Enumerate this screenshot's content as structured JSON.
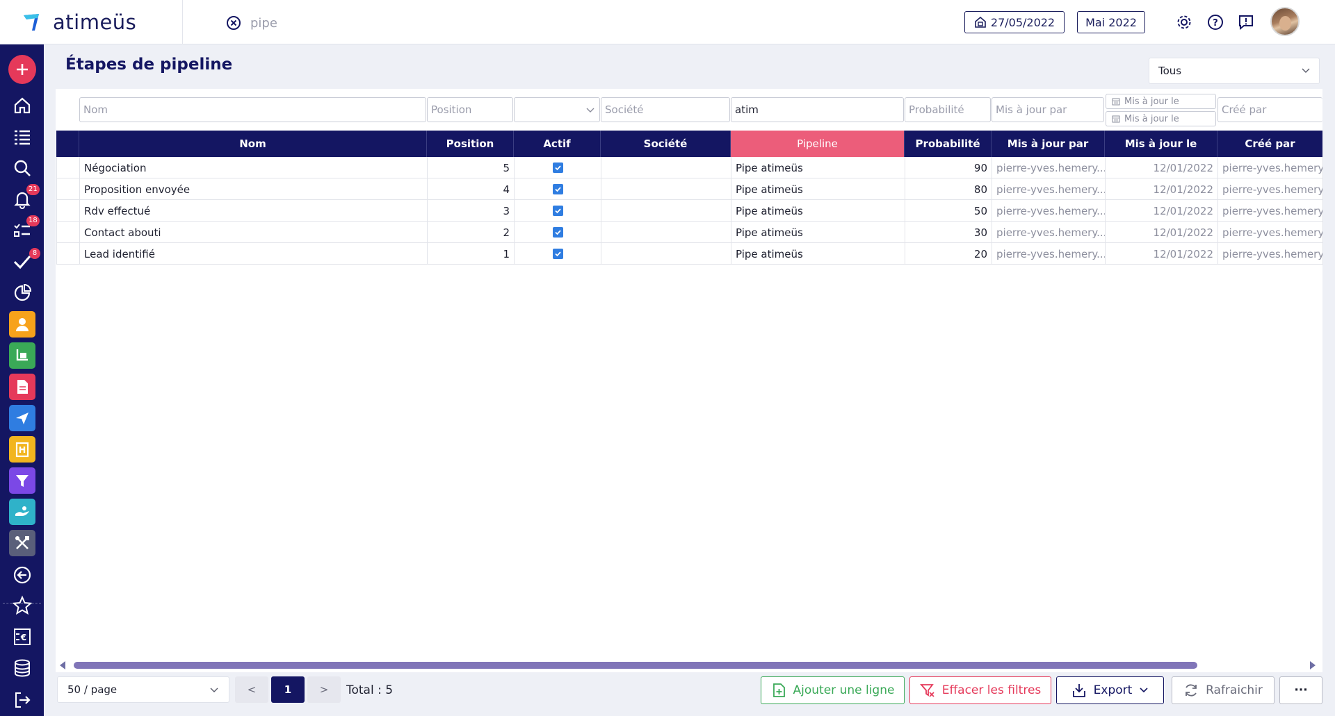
{
  "app": {
    "logo_text": "atimeüs"
  },
  "search": {
    "value": "pipe"
  },
  "header": {
    "date": "27/05/2022",
    "period": "Mai 2022"
  },
  "sidebar": {
    "badges": {
      "notifications": "21",
      "tasks": "18",
      "todo": "8"
    }
  },
  "page": {
    "title": "Étapes de pipeline",
    "scope_select": "Tous"
  },
  "filters": {
    "nom": {
      "placeholder": "Nom",
      "value": ""
    },
    "position": {
      "placeholder": "Position",
      "value": ""
    },
    "societe": {
      "placeholder": "Société",
      "value": ""
    },
    "pipeline": {
      "placeholder": "",
      "value": "atim"
    },
    "probabilite": {
      "placeholder": "Probabilité",
      "value": ""
    },
    "mis_a_jour_par": {
      "placeholder": "Mis à jour par",
      "value": ""
    },
    "mis_a_jour_le_from": "Mis à jour le",
    "mis_a_jour_le_to": "Mis à jour le",
    "cree_par": {
      "placeholder": "Créé par",
      "value": ""
    }
  },
  "table": {
    "columns": [
      "Nom",
      "Position",
      "Actif",
      "Société",
      "Pipeline",
      "Probabilité",
      "Mis à jour par",
      "Mis à jour le",
      "Créé par"
    ],
    "rows": [
      {
        "nom": "Négociation",
        "position": "5",
        "actif": true,
        "societe": "",
        "pipeline": "Pipe atimeüs",
        "probabilite": "90",
        "maj_par": "pierre-yves.hemery...",
        "maj_le": "12/01/2022",
        "cree_par": "pierre-yves.hemery.."
      },
      {
        "nom": "Proposition envoyée",
        "position": "4",
        "actif": true,
        "societe": "",
        "pipeline": "Pipe atimeüs",
        "probabilite": "80",
        "maj_par": "pierre-yves.hemery...",
        "maj_le": "12/01/2022",
        "cree_par": "pierre-yves.hemery.."
      },
      {
        "nom": "Rdv effectué",
        "position": "3",
        "actif": true,
        "societe": "",
        "pipeline": "Pipe atimeüs",
        "probabilite": "50",
        "maj_par": "pierre-yves.hemery...",
        "maj_le": "12/01/2022",
        "cree_par": "pierre-yves.hemery.."
      },
      {
        "nom": "Contact abouti",
        "position": "2",
        "actif": true,
        "societe": "",
        "pipeline": "Pipe atimeüs",
        "probabilite": "30",
        "maj_par": "pierre-yves.hemery...",
        "maj_le": "12/01/2022",
        "cree_par": "pierre-yves.hemery.."
      },
      {
        "nom": "Lead identifié",
        "position": "1",
        "actif": true,
        "societe": "",
        "pipeline": "Pipe atimeüs",
        "probabilite": "20",
        "maj_par": "pierre-yves.hemery...",
        "maj_le": "12/01/2022",
        "cree_par": "pierre-yves.hemery.."
      }
    ]
  },
  "footer": {
    "page_size": "50 / page",
    "prev": "<",
    "current_page": "1",
    "next": ">",
    "total": "Total : 5",
    "add_row": "Ajouter une ligne",
    "clear_filters": "Effacer les filtres",
    "export": "Export",
    "refresh": "Rafraichir",
    "more": "···"
  },
  "colors": {
    "navy": "#141662",
    "active_column": "#ec5d7a",
    "add_green": "#3aa957",
    "clear_red": "#e5395a",
    "checkbox_blue": "#2f7de1"
  }
}
